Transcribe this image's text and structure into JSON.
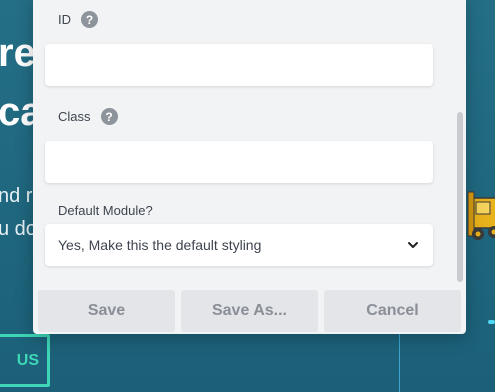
{
  "background": {
    "heading_line1": "re",
    "heading_line2": "ca",
    "text_line1": "nd r",
    "text_line2": "u do",
    "cta_label": "US"
  },
  "modal": {
    "id_field": {
      "label": "ID",
      "help_icon": "question-circle-icon",
      "value": ""
    },
    "class_field": {
      "label": "Class",
      "help_icon": "question-circle-icon",
      "value": ""
    },
    "default_module": {
      "label": "Default Module?",
      "selected": "Yes, Make this the default styling",
      "chevron_icon": "chevron-down-icon"
    },
    "buttons": {
      "save": "Save",
      "save_as": "Save As...",
      "cancel": "Cancel"
    }
  },
  "colors": {
    "page_bg": "#1e6a82",
    "modal_bg": "#f2f3f5",
    "accent_green": "#3ed6b7",
    "button_bg": "#e3e5e8",
    "button_text": "#8a8f97"
  }
}
